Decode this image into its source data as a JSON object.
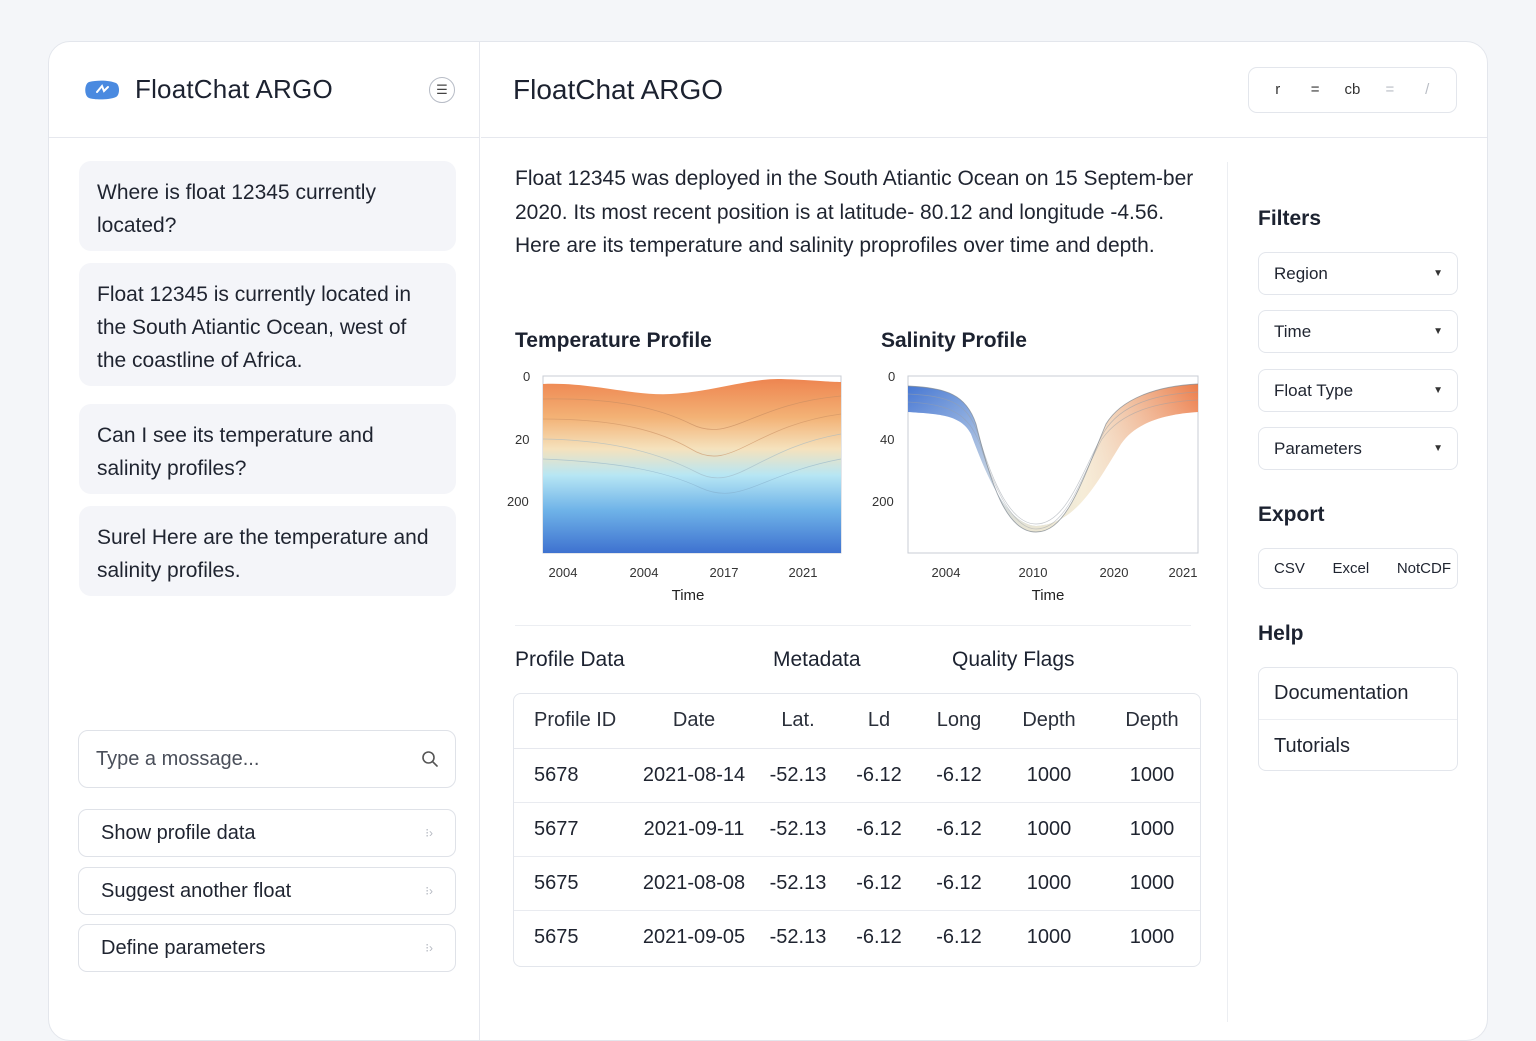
{
  "app": {
    "title": "FloatChat ARGO"
  },
  "sidebar": {
    "brand": "FloatChat ARGO",
    "messages": [
      {
        "role": "user",
        "text": "Where is float 12345 currently located?"
      },
      {
        "role": "assistant",
        "text": "Float 12345 is currently located in the South Atiantic Ocean, west of the coastline of Africa."
      },
      {
        "role": "user",
        "text": "Can I see its temperature and salinity profiles?"
      },
      {
        "role": "assistant",
        "text": "Surel Here are the temperature and salinity profiles."
      }
    ],
    "input": {
      "placeholder": "Type a mossage..."
    },
    "suggestions": [
      {
        "label": "Show profile data"
      },
      {
        "label": "Suggest another float"
      },
      {
        "label": "Define parameters"
      }
    ]
  },
  "main": {
    "title": "FloatChat ARGO",
    "toolbar": [
      "r",
      "=",
      "cb",
      "=",
      "/"
    ],
    "summary": "Float 12345 was deployed in the South Atiantic Ocean on 15 Septem-ber 2020. Its most recent position is at latitude- 80.12 and longitude -4.56. Here are its temperature and salinity proprofiles over time and depth.",
    "tabs": [
      "Profile Data",
      "Metadata",
      "Quality Flags"
    ],
    "table": {
      "columns": [
        "Profile ID",
        "Date",
        "Lat.",
        "Ld",
        "Long",
        "Depth",
        "Depth"
      ],
      "rows": [
        [
          "5678",
          "2021-08-14",
          "-52.13",
          "-6.12",
          "-6.12",
          "1000",
          "1000"
        ],
        [
          "5677",
          "2021-09-11",
          "-52.13",
          "-6.12",
          "-6.12",
          "1000",
          "1000"
        ],
        [
          "5675",
          "2021-08-08",
          "-52.13",
          "-6.12",
          "-6.12",
          "1000",
          "1000"
        ],
        [
          "5675",
          "2021-09-05",
          "-52.13",
          "-6.12",
          "-6.12",
          "1000",
          "1000"
        ]
      ]
    }
  },
  "panel": {
    "filters_title": "Filters",
    "filters": [
      "Region",
      "Time",
      "Float Type",
      "Parameters"
    ],
    "export_title": "Export",
    "export": [
      "CSV",
      "Excel",
      "NotCDF"
    ],
    "help_title": "Help",
    "help": [
      "Documentation",
      "Tutorials"
    ]
  },
  "colors": {
    "warm": "#ef8a54",
    "cool": "#4a7fd4",
    "pale": "#f3e9cf"
  },
  "chart_data": [
    {
      "type": "area",
      "title": "Temperature Profile",
      "xlabel": "Time",
      "ylabel": "",
      "x_tick_labels": [
        "2004",
        "2004",
        "2017",
        "2021"
      ],
      "y_tick_labels": [
        "0",
        "20",
        "200"
      ]
    },
    {
      "type": "area",
      "title": "Salinity Profile",
      "xlabel": "Time",
      "ylabel": "",
      "x_tick_labels": [
        "2004",
        "2010",
        "2020",
        "2021"
      ],
      "y_tick_labels": [
        "0",
        "40",
        "200"
      ]
    }
  ]
}
